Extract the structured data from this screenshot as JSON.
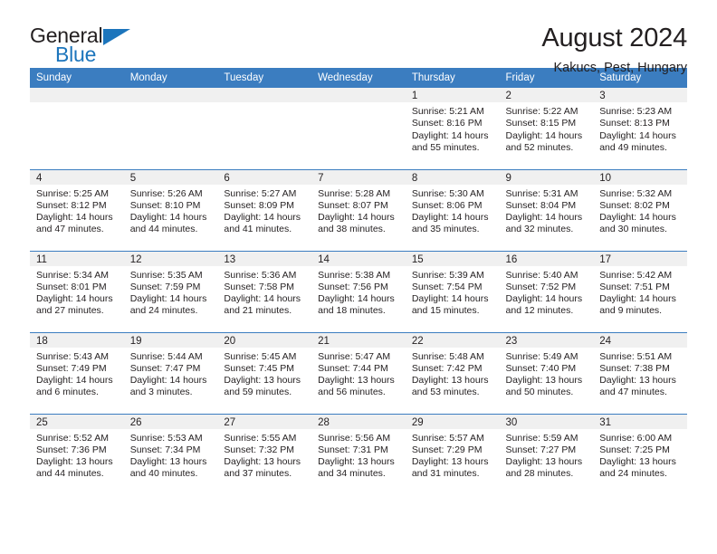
{
  "brand": {
    "name_top": "General",
    "name_bottom": "Blue",
    "accent_color": "#1c75bc"
  },
  "header": {
    "title": "August 2024",
    "subtitle": "Kakucs, Pest, Hungary"
  },
  "theme": {
    "header_row_color": "#3b7dc0",
    "daynum_strip_color": "#f0f0f0",
    "text_color": "#231f20"
  },
  "weekdays": [
    "Sunday",
    "Monday",
    "Tuesday",
    "Wednesday",
    "Thursday",
    "Friday",
    "Saturday"
  ],
  "weeks": [
    [
      {
        "day": "",
        "empty": true
      },
      {
        "day": "",
        "empty": true
      },
      {
        "day": "",
        "empty": true
      },
      {
        "day": "",
        "empty": true
      },
      {
        "day": "1",
        "sunrise": "Sunrise: 5:21 AM",
        "sunset": "Sunset: 8:16 PM",
        "daylight_1": "Daylight: 14 hours",
        "daylight_2": "and 55 minutes."
      },
      {
        "day": "2",
        "sunrise": "Sunrise: 5:22 AM",
        "sunset": "Sunset: 8:15 PM",
        "daylight_1": "Daylight: 14 hours",
        "daylight_2": "and 52 minutes."
      },
      {
        "day": "3",
        "sunrise": "Sunrise: 5:23 AM",
        "sunset": "Sunset: 8:13 PM",
        "daylight_1": "Daylight: 14 hours",
        "daylight_2": "and 49 minutes."
      }
    ],
    [
      {
        "day": "4",
        "sunrise": "Sunrise: 5:25 AM",
        "sunset": "Sunset: 8:12 PM",
        "daylight_1": "Daylight: 14 hours",
        "daylight_2": "and 47 minutes."
      },
      {
        "day": "5",
        "sunrise": "Sunrise: 5:26 AM",
        "sunset": "Sunset: 8:10 PM",
        "daylight_1": "Daylight: 14 hours",
        "daylight_2": "and 44 minutes."
      },
      {
        "day": "6",
        "sunrise": "Sunrise: 5:27 AM",
        "sunset": "Sunset: 8:09 PM",
        "daylight_1": "Daylight: 14 hours",
        "daylight_2": "and 41 minutes."
      },
      {
        "day": "7",
        "sunrise": "Sunrise: 5:28 AM",
        "sunset": "Sunset: 8:07 PM",
        "daylight_1": "Daylight: 14 hours",
        "daylight_2": "and 38 minutes."
      },
      {
        "day": "8",
        "sunrise": "Sunrise: 5:30 AM",
        "sunset": "Sunset: 8:06 PM",
        "daylight_1": "Daylight: 14 hours",
        "daylight_2": "and 35 minutes."
      },
      {
        "day": "9",
        "sunrise": "Sunrise: 5:31 AM",
        "sunset": "Sunset: 8:04 PM",
        "daylight_1": "Daylight: 14 hours",
        "daylight_2": "and 32 minutes."
      },
      {
        "day": "10",
        "sunrise": "Sunrise: 5:32 AM",
        "sunset": "Sunset: 8:02 PM",
        "daylight_1": "Daylight: 14 hours",
        "daylight_2": "and 30 minutes."
      }
    ],
    [
      {
        "day": "11",
        "sunrise": "Sunrise: 5:34 AM",
        "sunset": "Sunset: 8:01 PM",
        "daylight_1": "Daylight: 14 hours",
        "daylight_2": "and 27 minutes."
      },
      {
        "day": "12",
        "sunrise": "Sunrise: 5:35 AM",
        "sunset": "Sunset: 7:59 PM",
        "daylight_1": "Daylight: 14 hours",
        "daylight_2": "and 24 minutes."
      },
      {
        "day": "13",
        "sunrise": "Sunrise: 5:36 AM",
        "sunset": "Sunset: 7:58 PM",
        "daylight_1": "Daylight: 14 hours",
        "daylight_2": "and 21 minutes."
      },
      {
        "day": "14",
        "sunrise": "Sunrise: 5:38 AM",
        "sunset": "Sunset: 7:56 PM",
        "daylight_1": "Daylight: 14 hours",
        "daylight_2": "and 18 minutes."
      },
      {
        "day": "15",
        "sunrise": "Sunrise: 5:39 AM",
        "sunset": "Sunset: 7:54 PM",
        "daylight_1": "Daylight: 14 hours",
        "daylight_2": "and 15 minutes."
      },
      {
        "day": "16",
        "sunrise": "Sunrise: 5:40 AM",
        "sunset": "Sunset: 7:52 PM",
        "daylight_1": "Daylight: 14 hours",
        "daylight_2": "and 12 minutes."
      },
      {
        "day": "17",
        "sunrise": "Sunrise: 5:42 AM",
        "sunset": "Sunset: 7:51 PM",
        "daylight_1": "Daylight: 14 hours",
        "daylight_2": "and 9 minutes."
      }
    ],
    [
      {
        "day": "18",
        "sunrise": "Sunrise: 5:43 AM",
        "sunset": "Sunset: 7:49 PM",
        "daylight_1": "Daylight: 14 hours",
        "daylight_2": "and 6 minutes."
      },
      {
        "day": "19",
        "sunrise": "Sunrise: 5:44 AM",
        "sunset": "Sunset: 7:47 PM",
        "daylight_1": "Daylight: 14 hours",
        "daylight_2": "and 3 minutes."
      },
      {
        "day": "20",
        "sunrise": "Sunrise: 5:45 AM",
        "sunset": "Sunset: 7:45 PM",
        "daylight_1": "Daylight: 13 hours",
        "daylight_2": "and 59 minutes."
      },
      {
        "day": "21",
        "sunrise": "Sunrise: 5:47 AM",
        "sunset": "Sunset: 7:44 PM",
        "daylight_1": "Daylight: 13 hours",
        "daylight_2": "and 56 minutes."
      },
      {
        "day": "22",
        "sunrise": "Sunrise: 5:48 AM",
        "sunset": "Sunset: 7:42 PM",
        "daylight_1": "Daylight: 13 hours",
        "daylight_2": "and 53 minutes."
      },
      {
        "day": "23",
        "sunrise": "Sunrise: 5:49 AM",
        "sunset": "Sunset: 7:40 PM",
        "daylight_1": "Daylight: 13 hours",
        "daylight_2": "and 50 minutes."
      },
      {
        "day": "24",
        "sunrise": "Sunrise: 5:51 AM",
        "sunset": "Sunset: 7:38 PM",
        "daylight_1": "Daylight: 13 hours",
        "daylight_2": "and 47 minutes."
      }
    ],
    [
      {
        "day": "25",
        "sunrise": "Sunrise: 5:52 AM",
        "sunset": "Sunset: 7:36 PM",
        "daylight_1": "Daylight: 13 hours",
        "daylight_2": "and 44 minutes."
      },
      {
        "day": "26",
        "sunrise": "Sunrise: 5:53 AM",
        "sunset": "Sunset: 7:34 PM",
        "daylight_1": "Daylight: 13 hours",
        "daylight_2": "and 40 minutes."
      },
      {
        "day": "27",
        "sunrise": "Sunrise: 5:55 AM",
        "sunset": "Sunset: 7:32 PM",
        "daylight_1": "Daylight: 13 hours",
        "daylight_2": "and 37 minutes."
      },
      {
        "day": "28",
        "sunrise": "Sunrise: 5:56 AM",
        "sunset": "Sunset: 7:31 PM",
        "daylight_1": "Daylight: 13 hours",
        "daylight_2": "and 34 minutes."
      },
      {
        "day": "29",
        "sunrise": "Sunrise: 5:57 AM",
        "sunset": "Sunset: 7:29 PM",
        "daylight_1": "Daylight: 13 hours",
        "daylight_2": "and 31 minutes."
      },
      {
        "day": "30",
        "sunrise": "Sunrise: 5:59 AM",
        "sunset": "Sunset: 7:27 PM",
        "daylight_1": "Daylight: 13 hours",
        "daylight_2": "and 28 minutes."
      },
      {
        "day": "31",
        "sunrise": "Sunrise: 6:00 AM",
        "sunset": "Sunset: 7:25 PM",
        "daylight_1": "Daylight: 13 hours",
        "daylight_2": "and 24 minutes."
      }
    ]
  ]
}
